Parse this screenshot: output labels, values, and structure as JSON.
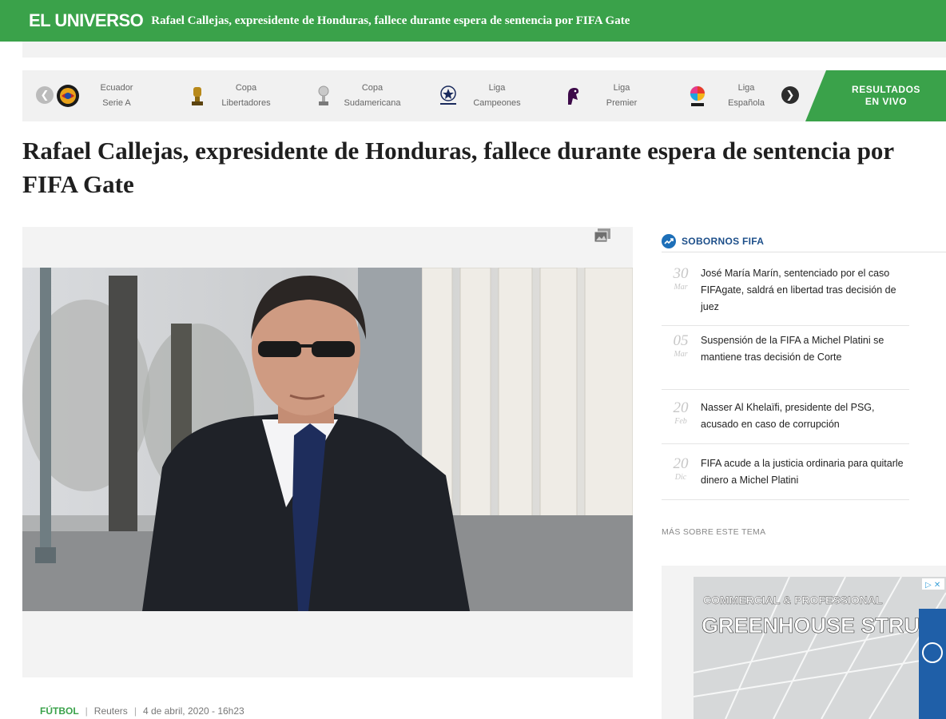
{
  "header": {
    "brand": "EL UNIVERSO",
    "title": "Rafael Callejas, expresidente de Honduras, fallece durante espera de sentencia por FIFA Gate"
  },
  "leagues": {
    "items": [
      {
        "line1": "Ecuador",
        "line2": "Serie A",
        "icon": "liga-pro-icon"
      },
      {
        "line1": "Copa",
        "line2": "Libertadores",
        "icon": "libertadores-trophy-icon"
      },
      {
        "line1": "Copa",
        "line2": "Sudamericana",
        "icon": "sudamericana-trophy-icon"
      },
      {
        "line1": "Liga",
        "line2": "Campeones",
        "icon": "champions-league-icon"
      },
      {
        "line1": "Liga",
        "line2": "Premier",
        "icon": "premier-league-icon"
      },
      {
        "line1": "Liga",
        "line2": "Española",
        "icon": "laliga-icon"
      }
    ],
    "results_line1": "RESULTADOS",
    "results_line2": "EN VIVO"
  },
  "article": {
    "headline": "Rafael Callejas, expresidente de Honduras, fallece durante espera de sentencia por FIFA Gate",
    "section": "FÚTBOL",
    "source": "Reuters",
    "date": "4 de abril, 2020 - 16h23"
  },
  "sidebar": {
    "topic": "SOBORNOS FIFA",
    "items": [
      {
        "day": "30",
        "month": "Mar",
        "text": "José María Marín, sentenciado por el caso FIFAgate, saldrá en libertad tras decisión de juez"
      },
      {
        "day": "05",
        "month": "Mar",
        "text": "Suspensión de la FIFA a Michel Platini se mantiene tras decisión de Corte"
      },
      {
        "day": "20",
        "month": "Feb",
        "text": "Nasser Al Khelaïfi, presidente del PSG, acusado en caso de corrupción"
      },
      {
        "day": "20",
        "month": "Dic",
        "text": "FIFA acude a la justicia ordinaria para quitarle dinero a Michel Platini"
      }
    ],
    "more": "MÁS SOBRE ESTE TEMA"
  },
  "ad": {
    "line1": "COMMERCIAL & PROFESSIONAL",
    "line2": "GREENHOUSE STRUCTURES"
  },
  "colors": {
    "brand_green": "#3aa24a",
    "topic_blue": "#1d6fb8"
  }
}
